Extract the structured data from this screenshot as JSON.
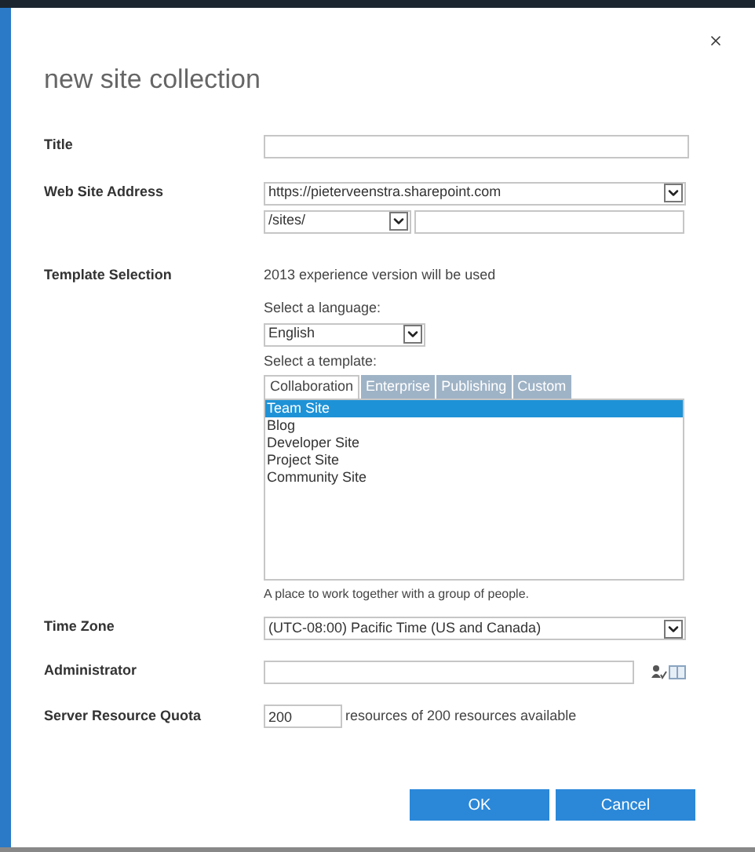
{
  "dialog": {
    "title": "new site collection"
  },
  "fields": [
    {
      "kind": "text",
      "label": "Title"
    },
    {
      "kind": "address",
      "label": "Web Site Address",
      "host": "https://pieterveenstra.sharepoint.com",
      "path": "/sites/"
    },
    {
      "kind": "template",
      "label": "Template Selection",
      "note": "2013 experience version will be used",
      "language_label": "Select a language:",
      "language": "English",
      "template_label": "Select a template:",
      "tabs": [
        {
          "label": "Collaboration",
          "selected": true
        },
        {
          "label": "Enterprise",
          "selected": false
        },
        {
          "label": "Publishing",
          "selected": false
        },
        {
          "label": "Custom",
          "selected": false
        }
      ],
      "templates": [
        {
          "label": "Team Site",
          "selected": true
        },
        {
          "label": "Blog",
          "selected": false
        },
        {
          "label": "Developer Site",
          "selected": false
        },
        {
          "label": "Project Site",
          "selected": false
        },
        {
          "label": "Community Site",
          "selected": false
        }
      ],
      "description": "A place to work together with a group of people."
    },
    {
      "kind": "select",
      "label": "Time Zone",
      "value": "(UTC-08:00) Pacific Time (US and Canada)"
    },
    {
      "kind": "people",
      "label": "Administrator"
    },
    {
      "kind": "quota",
      "label": "Server Resource Quota",
      "value": "200",
      "suffix": "resources of 200 resources available"
    }
  ],
  "buttons": [
    "OK",
    "Cancel"
  ]
}
